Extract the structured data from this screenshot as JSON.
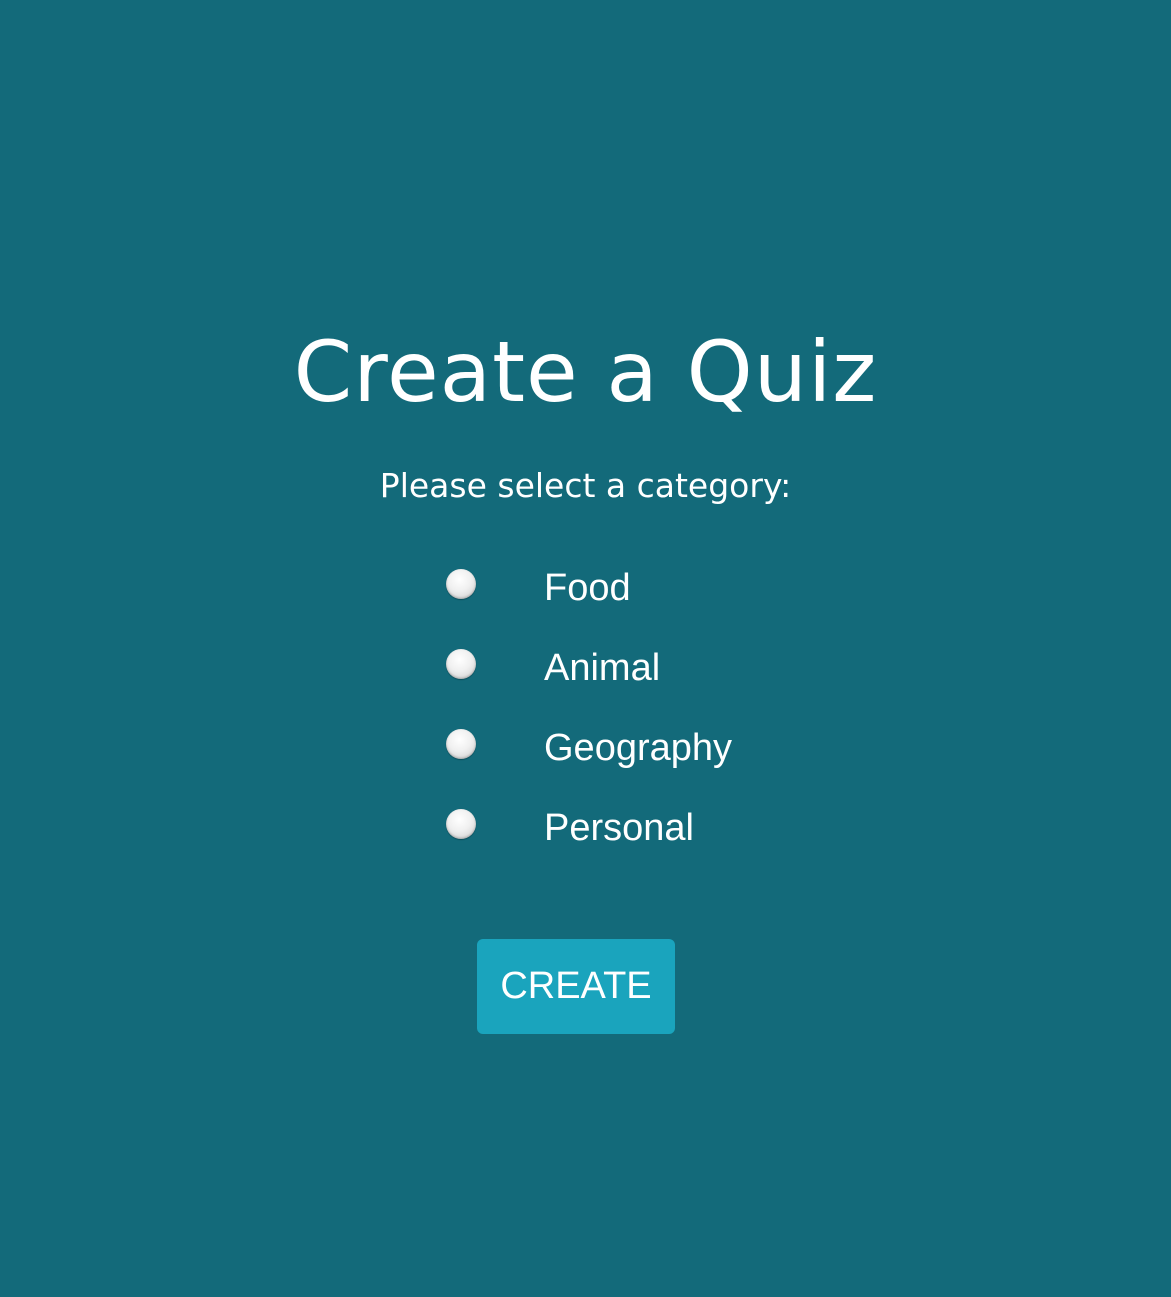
{
  "page": {
    "title": "Create a Quiz",
    "subtitle": "Please select a category:",
    "background_color": "#136a7a"
  },
  "categories": [
    {
      "label": "Food",
      "selected": false
    },
    {
      "label": "Animal",
      "selected": false
    },
    {
      "label": "Geography",
      "selected": false
    },
    {
      "label": "Personal",
      "selected": false
    }
  ],
  "create_button": {
    "label": "CREATE",
    "color": "#1aa4bd"
  }
}
